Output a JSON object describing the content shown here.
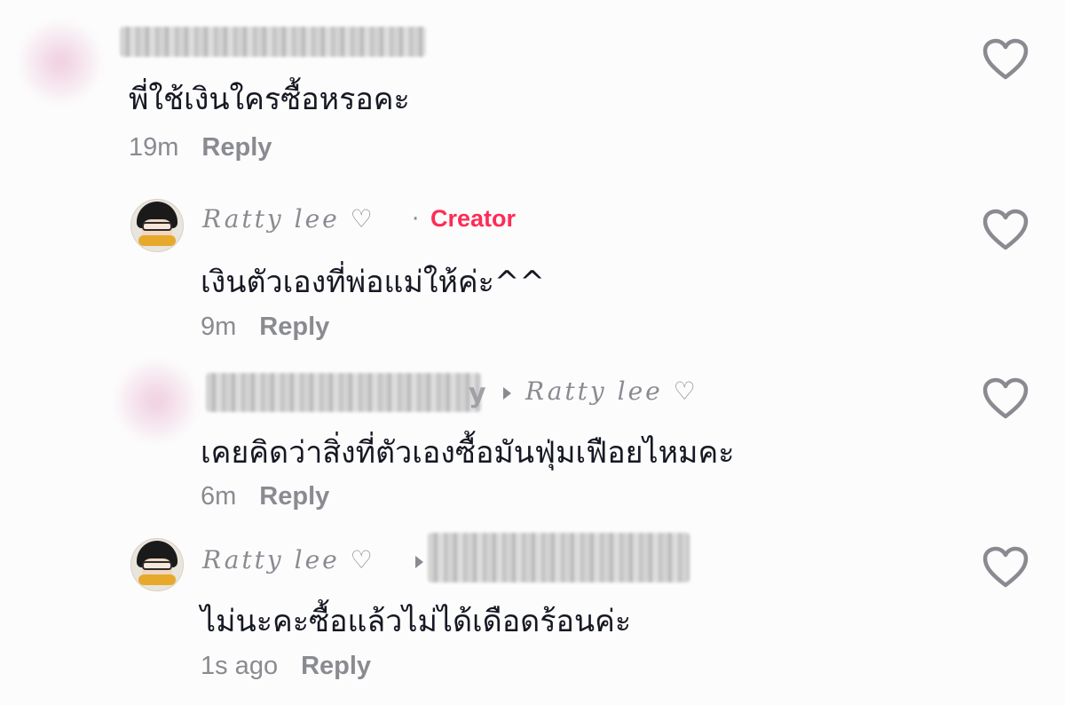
{
  "comments": [
    {
      "text": "พี่ใช้เงินใครซื้อหรอคะ",
      "time": "19m",
      "reply_label": "Reply"
    },
    {
      "username": "Ratty lee ♡",
      "badge": "Creator",
      "text": "เงินตัวเองที่พ่อแม่ให้ค่ะ^^",
      "time": "9m",
      "reply_label": "Reply"
    },
    {
      "username_tail": "y",
      "reply_to": "Ratty lee ♡",
      "text": "เคยคิดว่าสิ่งที่ตัวเองซื้อมันฟุ่มเฟือยไหมคะ",
      "time": "6m",
      "reply_label": "Reply"
    },
    {
      "username": "Ratty lee ♡",
      "text": "ไม่นะคะซื้อแล้วไม่ได้เดือดร้อนค่ะ",
      "time": "1s ago",
      "reply_label": "Reply"
    }
  ],
  "icons": {
    "like": "heart-outline-icon"
  },
  "colors": {
    "creator_badge": "#fe2c55",
    "meta": "#8a8b91",
    "text": "#161823"
  }
}
